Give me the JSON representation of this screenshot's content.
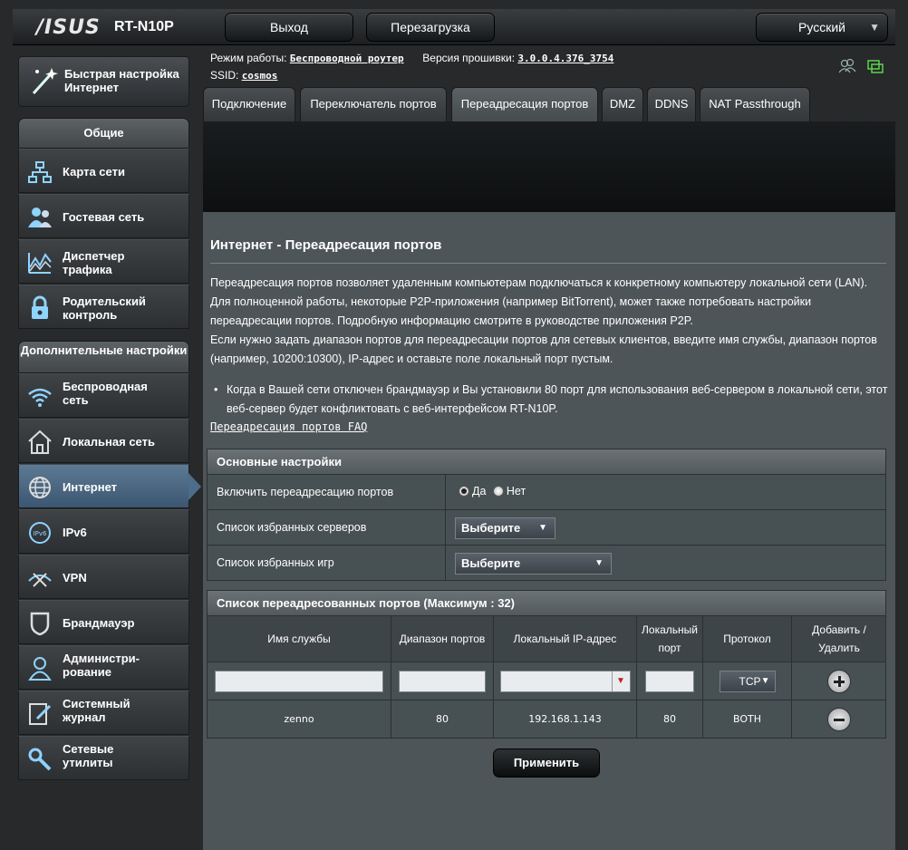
{
  "header": {
    "brand": "/ISUS",
    "model": "RT-N10P",
    "logout_label": "Выход",
    "reboot_label": "Перезагрузка",
    "language": "Русский"
  },
  "info": {
    "mode_label": "Режим работы:",
    "mode_value": "Беспроводной роутер",
    "fw_label": "Версия прошивки:",
    "fw_value": "3.0.0.4.376_3754",
    "ssid_label": "SSID:",
    "ssid_value": "cosmos"
  },
  "sidebar": {
    "quick_setup": "Быстрая настройка Интернет",
    "general_title": "Общие",
    "general_items": [
      {
        "label": "Карта сети"
      },
      {
        "label": "Гостевая сеть"
      },
      {
        "label": "Диспетчер трафика"
      },
      {
        "label": "Родительский контроль"
      }
    ],
    "advanced_title": "Дополнительные настройки",
    "advanced_items": [
      {
        "label": "Беспроводная сеть"
      },
      {
        "label": "Локальная сеть"
      },
      {
        "label": "Интернет"
      },
      {
        "label": "IPv6"
      },
      {
        "label": "VPN"
      },
      {
        "label": "Брандмауэр"
      },
      {
        "label": "Администри- рование"
      },
      {
        "label": "Системный журнал"
      },
      {
        "label": "Сетевые утилиты"
      }
    ]
  },
  "tabs": [
    "Подключение",
    "Переключатель портов",
    "Переадресация портов",
    "DMZ",
    "DDNS",
    "NAT Passthrough"
  ],
  "page": {
    "title": "Интернет - Переадресация портов",
    "desc1": "Переадресация портов позволяет удаленным компьютерам подключаться к конкретному компьютеру локальной сети (LAN). Для полноценной работы, некоторые P2P-приложения (например BitTorrent), может также потребовать настройки переадресации портов. Подробную информацию смотрите в руководстве приложения P2P.",
    "desc2": "Если нужно задать диапазон портов для переадресации портов для сетевых клиентов, введите имя службы, диапазон портов (например, 10200:10300), IP-адрес и оставьте поле локальный порт пустым.",
    "bullet": "Когда в Вашей сети отключен брандмауэр и Вы установили 80 порт для использования веб-сервером в локальной сети, этот веб-сервер будет конфликтовать с веб-интерфейсом RT-N10P.",
    "faq": "Переадресация портов FAQ"
  },
  "basic": {
    "title": "Основные настройки",
    "enable_label": "Включить переадресацию портов",
    "yes": "Да",
    "no": "Нет",
    "servers_label": "Список избранных серверов",
    "servers_value": "Выберите",
    "games_label": "Список избранных игр",
    "games_value": "Выберите"
  },
  "list": {
    "title": "Список переадресованных портов (Максимум : 32)",
    "headers": [
      "Имя службы",
      "Диапазон портов",
      "Локальный IP-адрес",
      "Локальный порт",
      "Протокол",
      "Добавить / Удалить"
    ],
    "protocol_value": "TCP",
    "rows": [
      {
        "service": "zenno",
        "range": "80",
        "ip": "192.168.1.143",
        "port": "80",
        "protocol": "BOTH"
      }
    ]
  },
  "apply_label": "Применить",
  "colors": {
    "content_bg": "#4d5558",
    "active_nav": "#4d6d8a",
    "status_green": "#5fd34a"
  }
}
